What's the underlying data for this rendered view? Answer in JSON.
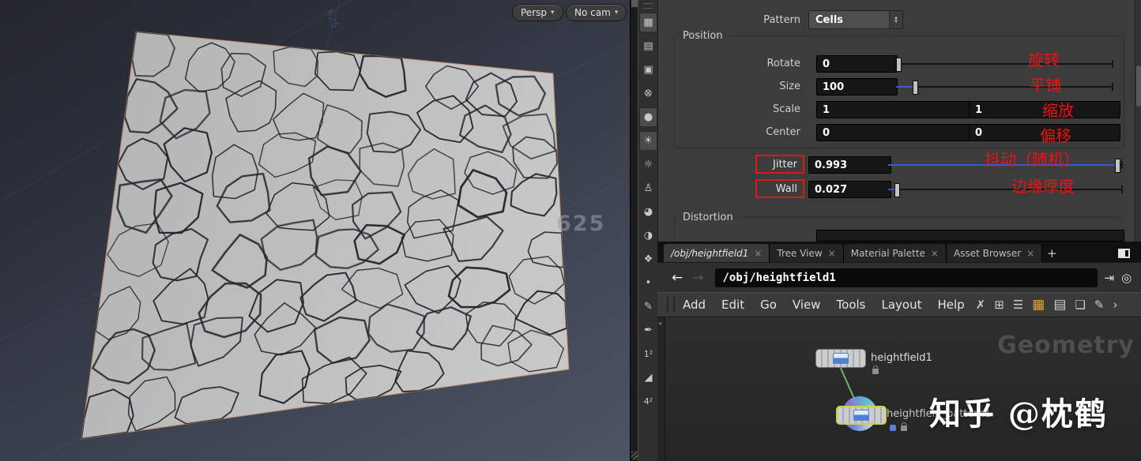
{
  "ui": {
    "spin_up": "▴",
    "spin_down": "▾"
  },
  "viewport": {
    "persp_button": "Persp",
    "nocam_button": "No cam",
    "dropdown_arrow": "▾",
    "axis_label_top": "625",
    "axis_label_right": "625"
  },
  "viewport_toolbar": {
    "icons": [
      {
        "name": "snapshot-icon",
        "glyph": "▦"
      },
      {
        "name": "scene-page-icon",
        "glyph": "▤"
      },
      {
        "name": "lock-icon",
        "glyph": "▣"
      },
      {
        "name": "no-cast-shadows-icon",
        "glyph": "⊗"
      },
      {
        "name": "smooth-shade-sphere-icon",
        "glyph": "●"
      },
      {
        "name": "headlight-on-icon",
        "glyph": "☀"
      },
      {
        "name": "headlight-off-icon",
        "glyph": "☼"
      },
      {
        "name": "mannequin-icon",
        "glyph": "♙"
      },
      {
        "name": "material-sphere-icon",
        "glyph": "◕"
      },
      {
        "name": "mirror-spheres-icon",
        "glyph": "◑"
      },
      {
        "name": "reflection-icon",
        "glyph": "❖"
      },
      {
        "name": "point-display-icon",
        "glyph": "•"
      },
      {
        "name": "brush-icon",
        "glyph": "✎"
      },
      {
        "name": "eyedropper-icon",
        "glyph": "✒"
      },
      {
        "name": "subdivision-1-icon",
        "glyph": "1²"
      },
      {
        "name": "ramp-icon",
        "glyph": "◢"
      },
      {
        "name": "subdivision-4-icon",
        "glyph": "4²"
      }
    ]
  },
  "params": {
    "pattern_label": "Pattern",
    "pattern_value": "Cells",
    "position_group": "Position",
    "rotate": {
      "label": "Rotate",
      "value": "0",
      "annotation": "旋转"
    },
    "size": {
      "label": "Size",
      "value": "100",
      "annotation": "平铺"
    },
    "scale": {
      "label": "Scale",
      "value1": "1",
      "value2": "1",
      "annotation": "缩放"
    },
    "center": {
      "label": "Center",
      "value1": "0",
      "value2": "0",
      "annotation": "偏移"
    },
    "jitter": {
      "label": "Jitter",
      "value": "0.993",
      "annotation": "抖动（随机）"
    },
    "wall": {
      "label": "Wall",
      "value": "0.027",
      "annotation": "边缘厚度"
    },
    "distortion_group": "Distortion"
  },
  "tabs": {
    "close_glyph": "×",
    "add_label": "+",
    "items": [
      {
        "label": "/obj/heightfield1"
      },
      {
        "label": "Tree View"
      },
      {
        "label": "Material Palette"
      },
      {
        "label": "Asset Browser"
      }
    ]
  },
  "pathbar": {
    "back_glyph": "←",
    "forward_glyph": "→",
    "path": "/obj/heightfield1",
    "pin_glyph": "⇥",
    "radial_glyph": "◎"
  },
  "menubar": {
    "items": [
      "Add",
      "Edit",
      "Go",
      "View",
      "Tools",
      "Layout",
      "Help"
    ],
    "icons": [
      {
        "name": "tools-icon",
        "glyph": "✗"
      },
      {
        "name": "tree-icon",
        "glyph": "⊞"
      },
      {
        "name": "list-icon",
        "glyph": "☰"
      },
      {
        "name": "grid-orange-icon",
        "glyph": "▦"
      },
      {
        "name": "table-icon",
        "glyph": "▤"
      },
      {
        "name": "panes-icon",
        "glyph": "❏"
      },
      {
        "name": "memo-icon",
        "glyph": "✎"
      },
      {
        "name": "more-chevron-icon",
        "glyph": "›"
      }
    ]
  },
  "network": {
    "pane_label": "Geometry",
    "node1_label": "heightfield1",
    "node2_label": "heightfield_pattern1"
  },
  "watermark": "知乎 @枕鹤"
}
